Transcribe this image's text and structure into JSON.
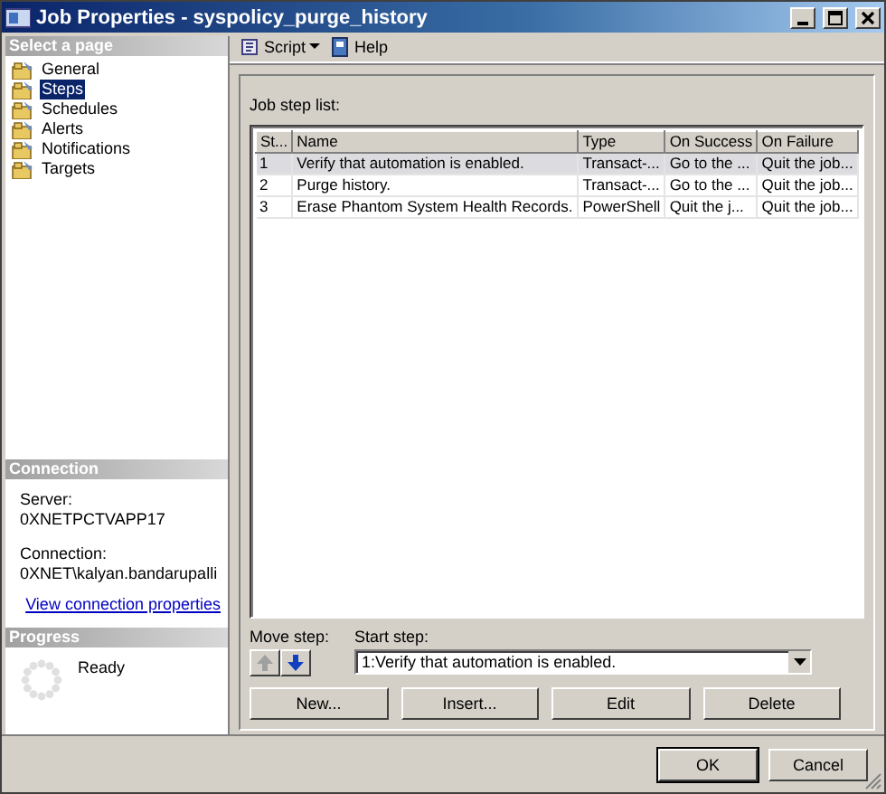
{
  "window": {
    "title": "Job Properties - syspolicy_purge_history"
  },
  "sidebar": {
    "header": "Select a page",
    "items": [
      {
        "label": "General",
        "selected": false
      },
      {
        "label": "Steps",
        "selected": true
      },
      {
        "label": "Schedules",
        "selected": false
      },
      {
        "label": "Alerts",
        "selected": false
      },
      {
        "label": "Notifications",
        "selected": false
      },
      {
        "label": "Targets",
        "selected": false
      }
    ]
  },
  "connection": {
    "header": "Connection",
    "server_label": "Server:",
    "server": "0XNETPCTVAPP17",
    "connection_label": "Connection:",
    "connection": "0XNET\\kalyan.bandarupalli",
    "link": "View connection properties"
  },
  "progress": {
    "header": "Progress",
    "status": "Ready"
  },
  "toolbar": {
    "script": "Script",
    "help": "Help"
  },
  "step_list": {
    "label": "Job step list:",
    "columns": [
      "St...",
      "Name",
      "Type",
      "On Success",
      "On Failure"
    ],
    "rows": [
      {
        "cells": [
          "1",
          "Verify that automation is enabled.",
          "Transact-...",
          "Go to the ...",
          "Quit the job..."
        ],
        "selected": true
      },
      {
        "cells": [
          "2",
          "Purge history.",
          "Transact-...",
          "Go to the ...",
          "Quit the job..."
        ],
        "selected": false
      },
      {
        "cells": [
          "3",
          "Erase Phantom System Health Records.",
          "PowerShell",
          "Quit the j...",
          "Quit the job..."
        ],
        "selected": false
      }
    ]
  },
  "move_step": {
    "label": "Move step:",
    "up_disabled": true,
    "down_disabled": false
  },
  "start_step": {
    "label": "Start step:",
    "value": "1:Verify that automation is enabled."
  },
  "step_buttons": [
    "New...",
    "Insert...",
    "Edit",
    "Delete"
  ],
  "footer_buttons": [
    "OK",
    "Cancel"
  ]
}
